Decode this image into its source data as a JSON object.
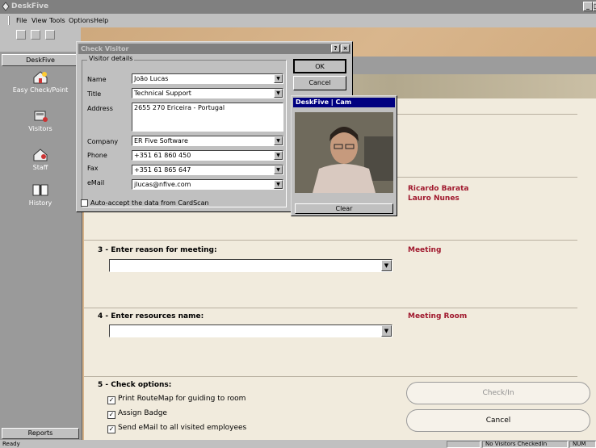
{
  "app": {
    "title": "DeskFive"
  },
  "window_buttons": {
    "minimize": "_",
    "restore": "□"
  },
  "menu": [
    "File",
    "View",
    "Tools",
    "Options",
    "Help"
  ],
  "sidebar": {
    "header": "DeskFive",
    "items": [
      {
        "label": "Easy Check/Point",
        "icon": "easy-check-icon"
      },
      {
        "label": "Visitors",
        "icon": "visitors-icon"
      },
      {
        "label": "Staff",
        "icon": "staff-icon"
      },
      {
        "label": "History",
        "icon": "history-icon"
      }
    ],
    "footer": "Reports"
  },
  "status": {
    "left": "Ready",
    "visitors": "No Visitors CheckedIn",
    "num": "NUM"
  },
  "dialog": {
    "title": "Check Visitor",
    "help": "?",
    "close": "×",
    "group": "Visitor details",
    "fields": {
      "name": {
        "label": "Name",
        "value": "João Lucas"
      },
      "title": {
        "label": "Title",
        "value": "Technical Support"
      },
      "address": {
        "label": "Address",
        "value": "2655 270 Ericeira - Portugal"
      },
      "company": {
        "label": "Company",
        "value": "ER Five Software"
      },
      "phone": {
        "label": "Phone",
        "value": "+351 61 860 450"
      },
      "fax": {
        "label": "Fax",
        "value": "+351 61 865 647"
      },
      "email": {
        "label": "eMail",
        "value": "jlucas@nfive.com"
      }
    },
    "autoaccept": "Auto-accept the data from CardScan",
    "ok": "OK",
    "cancel": "Cancel"
  },
  "cam": {
    "title": "DeskFive | Cam",
    "clear": "Clear"
  },
  "main": {
    "staff_names": [
      "Ricardo Barata",
      "Lauro Nunes"
    ],
    "step3": {
      "label": "3 - Enter reason for meeting:",
      "summary": "Meeting"
    },
    "step4": {
      "label": "4 - Enter resources name:",
      "summary": "Meeting Room"
    },
    "step5": {
      "label": "5 - Check options:",
      "options": [
        "Print RouteMap for guiding to room",
        "Assign Badge",
        "Send eMail to all visited employees"
      ]
    },
    "checkin": "Check/In",
    "cancel": "Cancel"
  }
}
